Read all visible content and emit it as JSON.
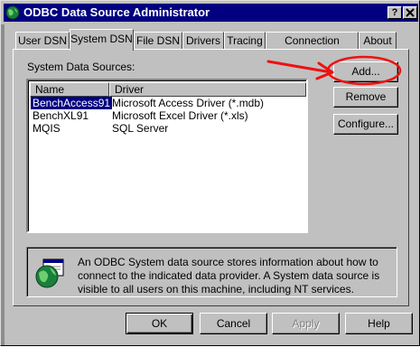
{
  "window": {
    "title": "ODBC Data Source Administrator",
    "help_button": "?",
    "close_button": "X"
  },
  "tabs": [
    {
      "label": "User DSN",
      "active": false
    },
    {
      "label": "System DSN",
      "active": true
    },
    {
      "label": "File DSN",
      "active": false
    },
    {
      "label": "Drivers",
      "active": false
    },
    {
      "label": "Tracing",
      "active": false
    },
    {
      "label": "Connection Pooling",
      "active": false
    },
    {
      "label": "About",
      "active": false
    }
  ],
  "panel": {
    "sources_label": "System Data Sources:",
    "columns": [
      "Name",
      "Driver"
    ],
    "rows": [
      {
        "name": "BenchAccess91",
        "driver": "Microsoft Access Driver (*.mdb)",
        "selected": true
      },
      {
        "name": "BenchXL91",
        "driver": "Microsoft Excel Driver (*.xls)",
        "selected": false
      },
      {
        "name": "MQIS",
        "driver": "SQL Server",
        "selected": false
      }
    ],
    "buttons": {
      "add": "Add...",
      "remove": "Remove",
      "configure": "Configure..."
    },
    "info_text": "An ODBC System data source stores information about how to connect to the indicated data provider.   A System data source is visible to all users on this machine, including NT services."
  },
  "footer": {
    "ok": "OK",
    "cancel": "Cancel",
    "apply": "Apply",
    "help": "Help"
  },
  "annotation_color": "#ee1111"
}
